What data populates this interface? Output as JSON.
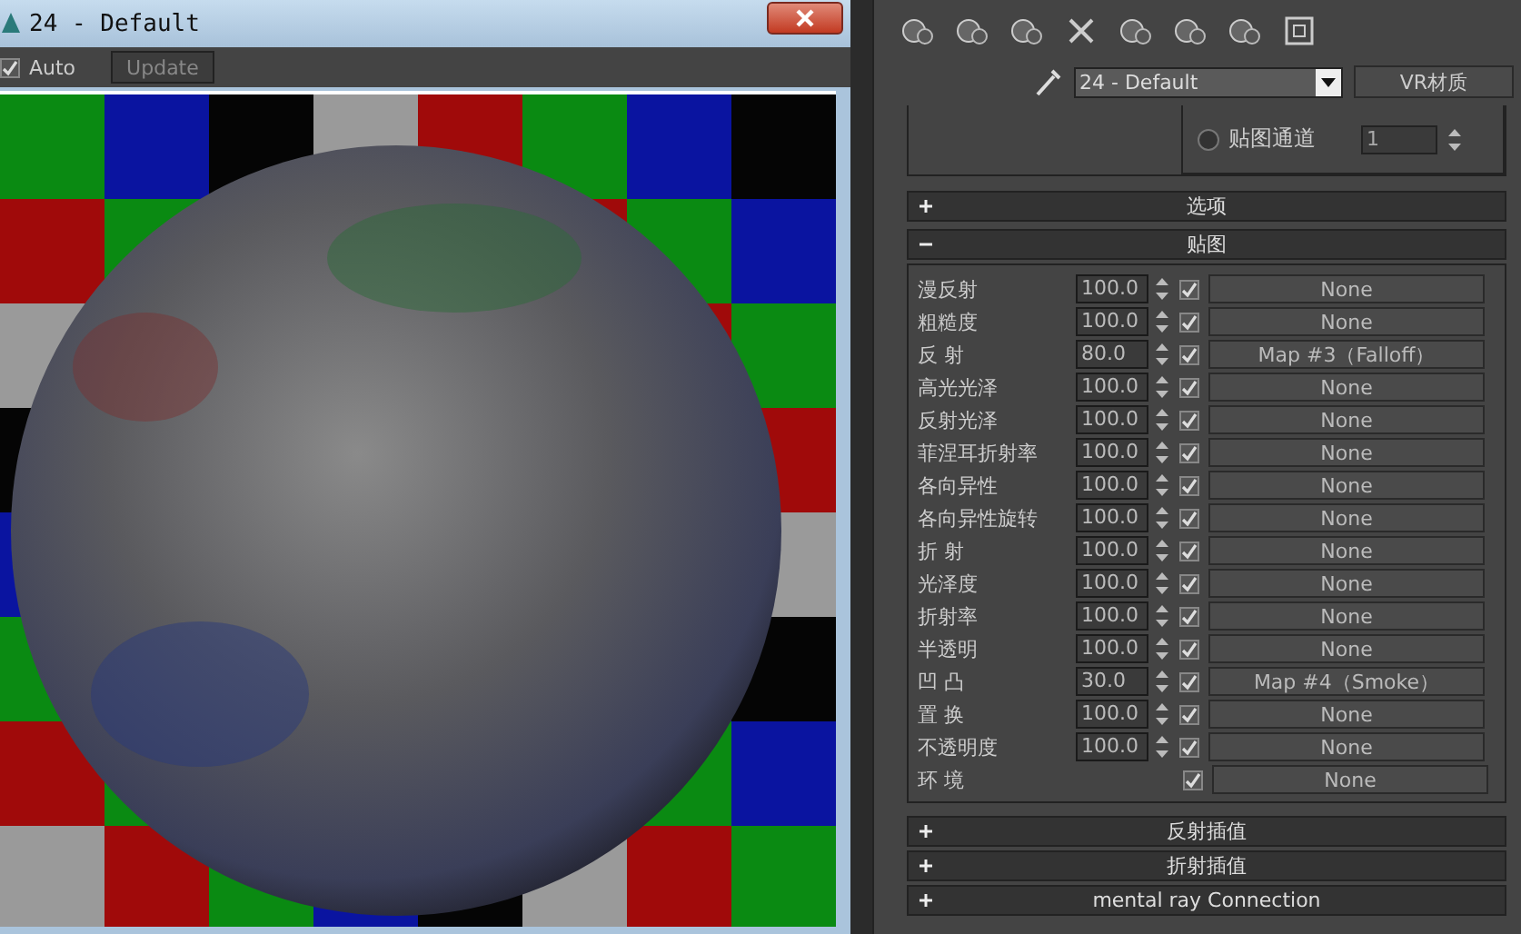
{
  "preview_window": {
    "title": "24 - Default",
    "auto": {
      "label": "Auto",
      "checked": true
    },
    "update_button": "Update"
  },
  "material_editor": {
    "material_name": "24 - Default",
    "material_type": "VR材质",
    "map_channel": {
      "label": "贴图通道",
      "selected": false,
      "value": "1"
    },
    "rollouts": [
      {
        "label": "选项",
        "expanded": false
      },
      {
        "label": "贴图",
        "expanded": true
      }
    ],
    "maps": [
      {
        "label": "漫反射",
        "amount": "100.0",
        "enabled": true,
        "map": "None"
      },
      {
        "label": "粗糙度",
        "amount": "100.0",
        "enabled": true,
        "map": "None"
      },
      {
        "label": "反 射",
        "amount": "80.0",
        "enabled": true,
        "map": "Map #3（Falloff）"
      },
      {
        "label": "高光光泽",
        "amount": "100.0",
        "enabled": true,
        "map": "None"
      },
      {
        "label": "反射光泽",
        "amount": "100.0",
        "enabled": true,
        "map": "None"
      },
      {
        "label": "菲涅耳折射率",
        "amount": "100.0",
        "enabled": true,
        "map": "None"
      },
      {
        "label": "各向异性",
        "amount": "100.0",
        "enabled": true,
        "map": "None"
      },
      {
        "label": "各向异性旋转",
        "amount": "100.0",
        "enabled": true,
        "map": "None"
      },
      {
        "label": "折 射",
        "amount": "100.0",
        "enabled": true,
        "map": "None"
      },
      {
        "label": "光泽度",
        "amount": "100.0",
        "enabled": true,
        "map": "None"
      },
      {
        "label": "折射率",
        "amount": "100.0",
        "enabled": true,
        "map": "None"
      },
      {
        "label": "半透明",
        "amount": "100.0",
        "enabled": true,
        "map": "None"
      },
      {
        "label": "凹 凸",
        "amount": "30.0",
        "enabled": true,
        "map": "Map #4（Smoke）"
      },
      {
        "label": "置 换",
        "amount": "100.0",
        "enabled": true,
        "map": "None"
      },
      {
        "label": "不透明度",
        "amount": "100.0",
        "enabled": true,
        "map": "None"
      },
      {
        "label": "环 境",
        "enabled": true,
        "map": "None"
      }
    ],
    "bottom_rollouts": [
      {
        "label": "反射插值",
        "expanded": false
      },
      {
        "label": "折射插值",
        "expanded": false
      },
      {
        "label": "mental ray Connection",
        "expanded": false
      }
    ]
  }
}
